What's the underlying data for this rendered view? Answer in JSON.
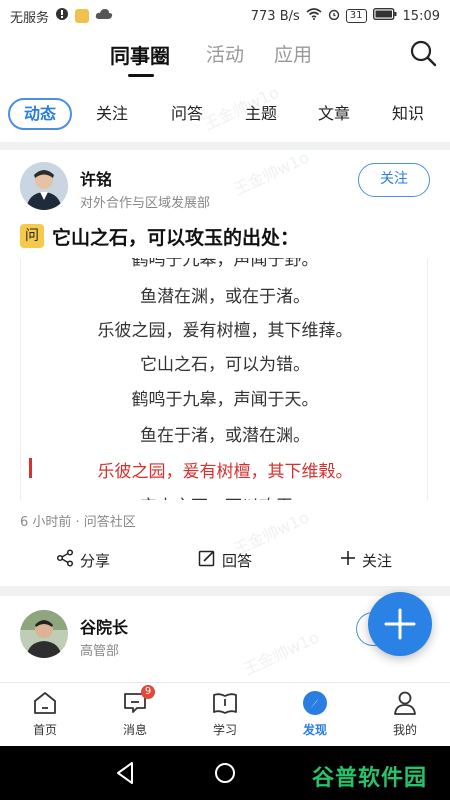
{
  "status_bar": {
    "carrier": "无服务",
    "speed": "773 B/s",
    "calendar": "31",
    "time": "15:09"
  },
  "header": {
    "tabs": [
      "同事圈",
      "活动",
      "应用"
    ]
  },
  "subtabs": [
    "动态",
    "关注",
    "问答",
    "主题",
    "文章",
    "知识"
  ],
  "post": {
    "author": "许铭",
    "department": "对外合作与区域发展部",
    "follow_label": "关注",
    "question_badge": "问",
    "question_title": "它山之石，可以攻玉的出处：",
    "poem_lines": [
      {
        "text": "鹤鸣于九皋，声闻于野。",
        "highlight": false
      },
      {
        "text": "鱼潜在渊，或在于渚。",
        "highlight": false
      },
      {
        "text": "乐彼之园，爰有树檀，其下维萚。",
        "highlight": false
      },
      {
        "text": "它山之石，可以为错。",
        "highlight": false
      },
      {
        "text": "鹤鸣于九皋，声闻于天。",
        "highlight": false
      },
      {
        "text": "鱼在于渚，或潜在渊。",
        "highlight": false
      },
      {
        "text": "乐彼之园，爰有树檀，其下维榖。",
        "highlight": true
      },
      {
        "text": "它山之石，可以攻玉。",
        "highlight": false
      }
    ],
    "meta": "6 小时前 · 问答社区",
    "actions": {
      "share": "分享",
      "answer": "回答",
      "follow": "关注"
    }
  },
  "post2": {
    "author": "谷院长",
    "department": "高管部"
  },
  "bottom_nav": {
    "items": [
      {
        "label": "首页",
        "icon": "home-icon"
      },
      {
        "label": "消息",
        "icon": "message-icon",
        "badge": "9"
      },
      {
        "label": "学习",
        "icon": "book-icon"
      },
      {
        "label": "发现",
        "icon": "compass-icon"
      },
      {
        "label": "我的",
        "icon": "user-icon"
      }
    ]
  },
  "watermark_text": "王金帅w1o",
  "brand_watermark": "谷普软件园",
  "colors": {
    "accent": "#2a7de1",
    "highlight_red": "#d8302c",
    "badge_yellow": "#f7c94a",
    "badge_red": "#e04a3a"
  }
}
